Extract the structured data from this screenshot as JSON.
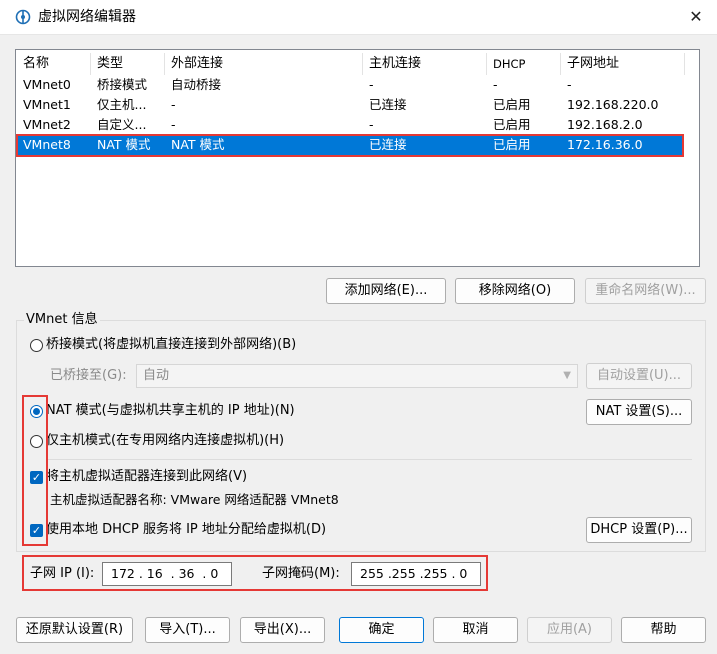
{
  "window": {
    "title": "虚拟网络编辑器",
    "close_glyph": "✕"
  },
  "table": {
    "headers": [
      "名称",
      "类型",
      "外部连接",
      "主机连接",
      "DHCP",
      "子网地址"
    ],
    "rows": [
      [
        "VMnet0",
        "桥接模式",
        "自动桥接",
        "-",
        "-",
        "-"
      ],
      [
        "VMnet1",
        "仅主机...",
        "-",
        "已连接",
        "已启用",
        "192.168.220.0"
      ],
      [
        "VMnet2",
        "自定义...",
        "-",
        "-",
        "已启用",
        "192.168.2.0"
      ],
      [
        "VMnet8",
        "NAT 模式",
        "NAT 模式",
        "已连接",
        "已启用",
        "172.16.36.0"
      ]
    ],
    "selected_row": "VMnet8"
  },
  "table_buttons": {
    "add": "添加网络(E)...",
    "remove": "移除网络(O)",
    "rename": "重命名网络(W)..."
  },
  "vmnet_info": {
    "label": "VMnet 信息",
    "bridge_mode": "桥接模式(将虚拟机直接连接到外部网络)(B)",
    "bridged_to_label": "已桥接至(G):",
    "bridged_to_value": "自动",
    "auto_settings": "自动设置(U)...",
    "nat_mode": "NAT 模式(与虚拟机共享主机的 IP 地址)(N)",
    "nat_settings": "NAT 设置(S)...",
    "host_only_mode": "仅主机模式(在专用网络内连接虚拟机)(H)",
    "connect_adapter": "将主机虚拟适配器连接到此网络(V)",
    "adapter_name": "主机虚拟适配器名称: VMware 网络适配器 VMnet8",
    "use_dhcp": "使用本地 DHCP 服务将 IP 地址分配给虚拟机(D)",
    "dhcp_settings": "DHCP 设置(P)...",
    "selected_mode": "nat",
    "connect_adapter_checked": true,
    "use_dhcp_checked": true
  },
  "subnet": {
    "ip_label": "子网 IP (I):",
    "ip_value": "172 . 16  . 36  . 0",
    "mask_label": "子网掩码(M):",
    "mask_value": "255 .255 .255 . 0"
  },
  "footer": {
    "restore": "还原默认设置(R)",
    "import": "导入(T)...",
    "export": "导出(X)...",
    "ok": "确定",
    "cancel": "取消",
    "apply": "应用(A)",
    "help": "帮助"
  },
  "colors": {
    "selection": "#0078d7",
    "highlight_box": "#e53935",
    "radio_check": "#0067c0"
  },
  "icons": [
    "network-editor-icon",
    "close-icon",
    "dropdown-arrow-icon",
    "check-icon"
  ]
}
